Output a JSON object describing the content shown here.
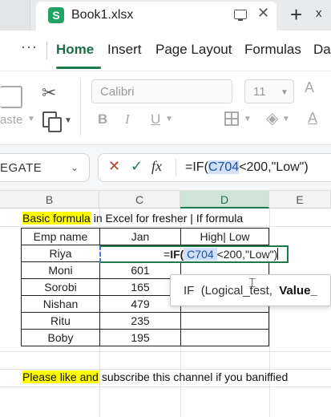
{
  "titlebar": {
    "doc_title": "Book1.xlsx",
    "logo_letter": "S",
    "more_tab_stub": "x",
    "new_tab_glyph": "+",
    "close_glyph": "✕"
  },
  "menu": {
    "more_glyph": "···",
    "tabs": [
      {
        "label": "Home",
        "active": true
      },
      {
        "label": "Insert",
        "active": false
      },
      {
        "label": "Page Layout",
        "active": false
      },
      {
        "label": "Formulas",
        "active": false
      },
      {
        "label": "Da",
        "active": false
      }
    ]
  },
  "ribbon": {
    "paste_label": "aste",
    "font_name": "Calibri",
    "font_size": "11",
    "bold": "B",
    "italic": "I",
    "underline": "U",
    "font_color_glyph": "A"
  },
  "formula_bar": {
    "name_box": "EGATE",
    "fx_label": "fx",
    "formula_parts": {
      "prefix": "=IF(",
      "ref": "C704",
      "suffix": "<200,\"Low\")"
    }
  },
  "sheet": {
    "columns": [
      "B",
      "C",
      "D",
      "E"
    ],
    "selected_column": "D",
    "banner": {
      "highlighted": "Basic formula",
      "rest": " in Excel for fresher | If formula"
    },
    "table": {
      "headers": [
        "Emp name",
        "Jan",
        "High| Low"
      ],
      "rows": [
        [
          "Riya",
          "",
          ""
        ],
        [
          "Moni",
          "601",
          ""
        ],
        [
          "Sorobi",
          "165",
          ""
        ],
        [
          "Nishan",
          "479",
          ""
        ],
        [
          "Ritu",
          "235",
          ""
        ],
        [
          "Boby",
          "195",
          ""
        ]
      ]
    },
    "editing_cell": {
      "prefix": "=",
      "bold_part": "IF(",
      "ref": " C704 ",
      "suffix": "<200,\"Low\""
    },
    "tooltip": {
      "fn": "IF",
      "arg1": "(Logical_test,",
      "arg2": "Value_"
    },
    "footer": {
      "highlighted": "Please like and",
      "rest": " subscribe this channel if you baniffied"
    }
  },
  "colors": {
    "accent_green": "#1d7a4a",
    "highlight_yellow": "#ffff00",
    "ref_blue": "#cfe0f7"
  }
}
